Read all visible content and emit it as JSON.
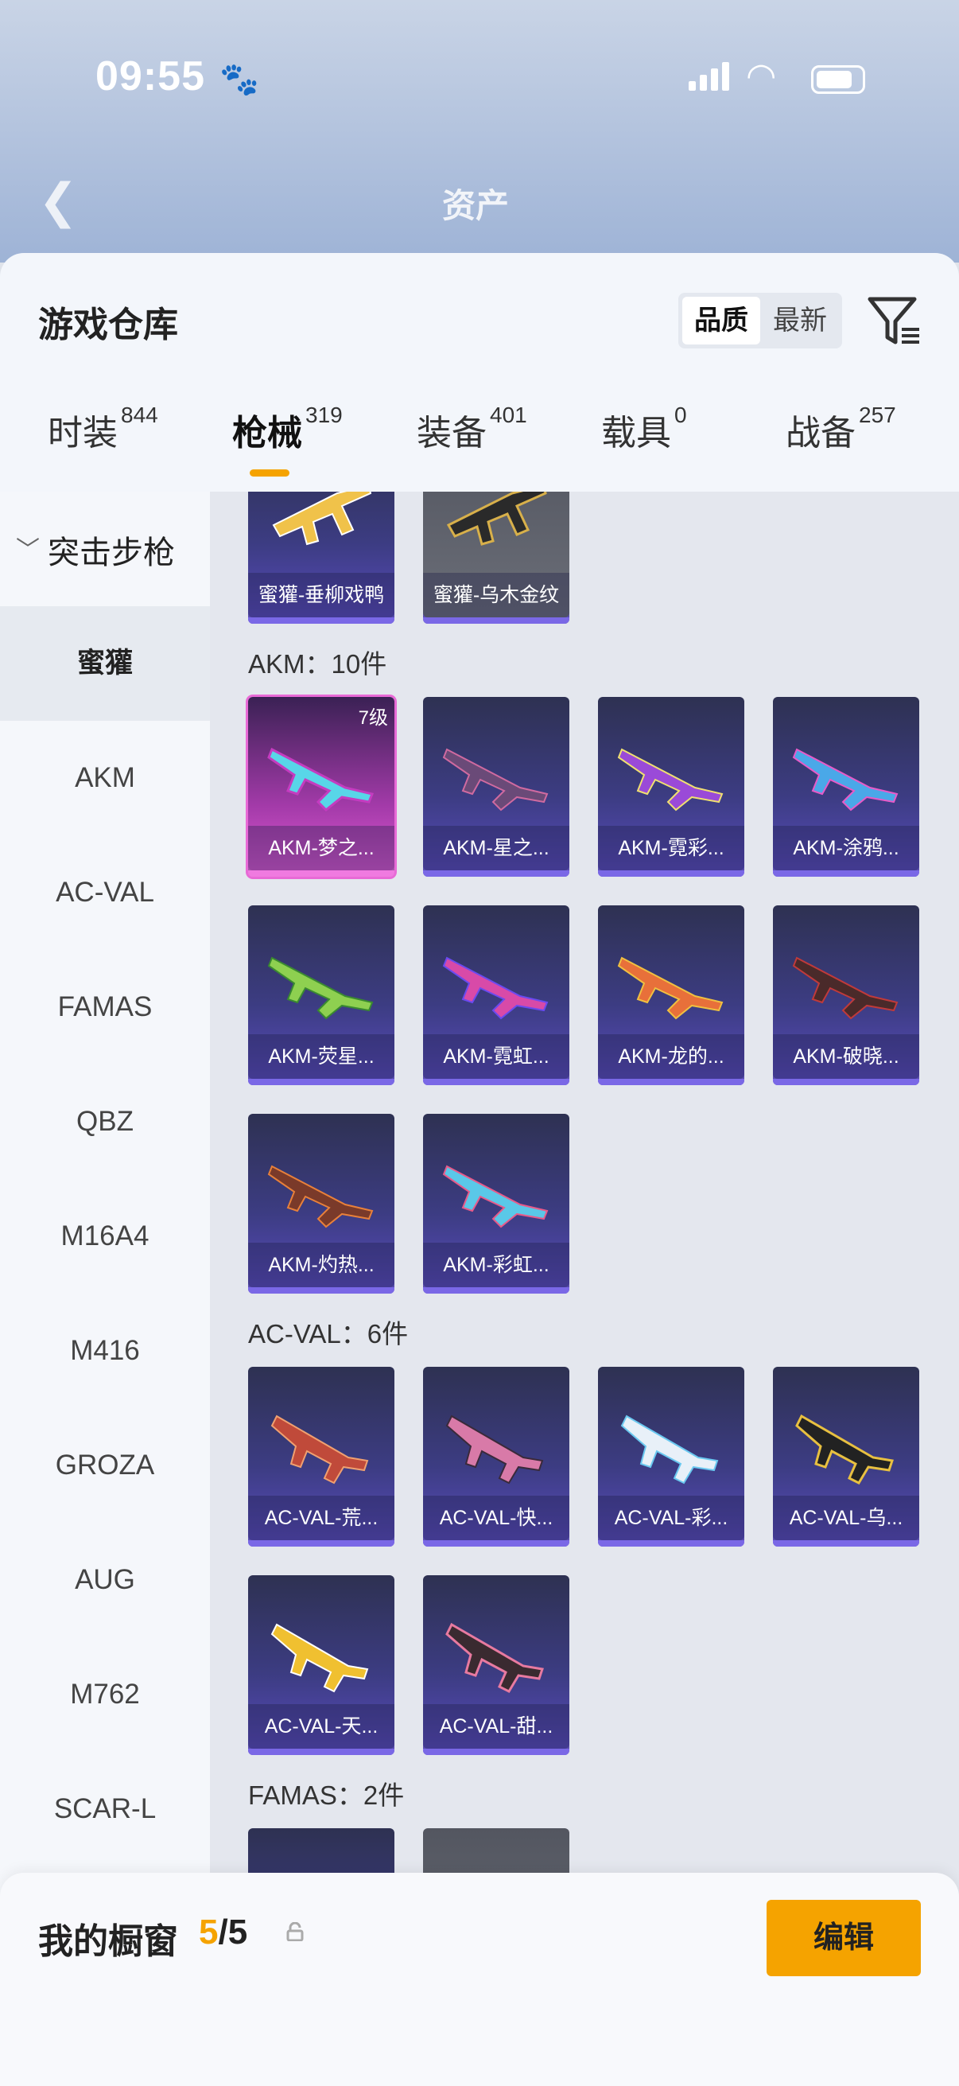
{
  "status": {
    "time": "09:55"
  },
  "header": {
    "asset_title": "资产"
  },
  "sheet": {
    "title": "游戏仓库"
  },
  "sort": {
    "quality_label": "品质",
    "latest_label": "最新"
  },
  "tabs": [
    {
      "label": "时装",
      "count": "844"
    },
    {
      "label": "枪械",
      "count": "319"
    },
    {
      "label": "装备",
      "count": "401"
    },
    {
      "label": "载具",
      "count": "0"
    },
    {
      "label": "战备",
      "count": "257"
    }
  ],
  "sidebar": {
    "category": "突击步枪",
    "items": [
      "蜜獾",
      "AKM",
      "AC-VAL",
      "FAMAS",
      "QBZ",
      "M16A4",
      "M416",
      "GROZA",
      "AUG",
      "M762",
      "SCAR-L"
    ]
  },
  "sections": {
    "top_cards": [
      "蜜獾-垂柳戏鸭",
      "蜜獾-乌木金纹"
    ],
    "akm": {
      "title": "AKM：10件",
      "cards": [
        "AKM-梦之...",
        "AKM-星之...",
        "AKM-霓彩...",
        "AKM-涂鸦...",
        "AKM-荧星...",
        "AKM-霓虹...",
        "AKM-龙的...",
        "AKM-破晓...",
        "AKM-灼热...",
        "AKM-彩虹..."
      ],
      "first_level": "7级"
    },
    "acval": {
      "title": "AC-VAL：6件",
      "cards": [
        "AC-VAL-荒...",
        "AC-VAL-快...",
        "AC-VAL-彩...",
        "AC-VAL-乌...",
        "AC-VAL-天...",
        "AC-VAL-甜..."
      ]
    },
    "famas": {
      "title": "FAMAS：2件"
    }
  },
  "showcase": {
    "title": "我的橱窗",
    "current": "5",
    "total": "/5",
    "edit_label": "编辑"
  },
  "colors": {
    "accent": "#f5a300",
    "card_purple": "#5a4cbf",
    "card_pink": "#e25ad6"
  },
  "icons": [
    "back-arrow-icon",
    "filter-icon",
    "chevron-down-icon",
    "share-out-icon",
    "lock-icon",
    "paw-icon",
    "wifi-icon",
    "signal-icon",
    "battery-icon"
  ]
}
